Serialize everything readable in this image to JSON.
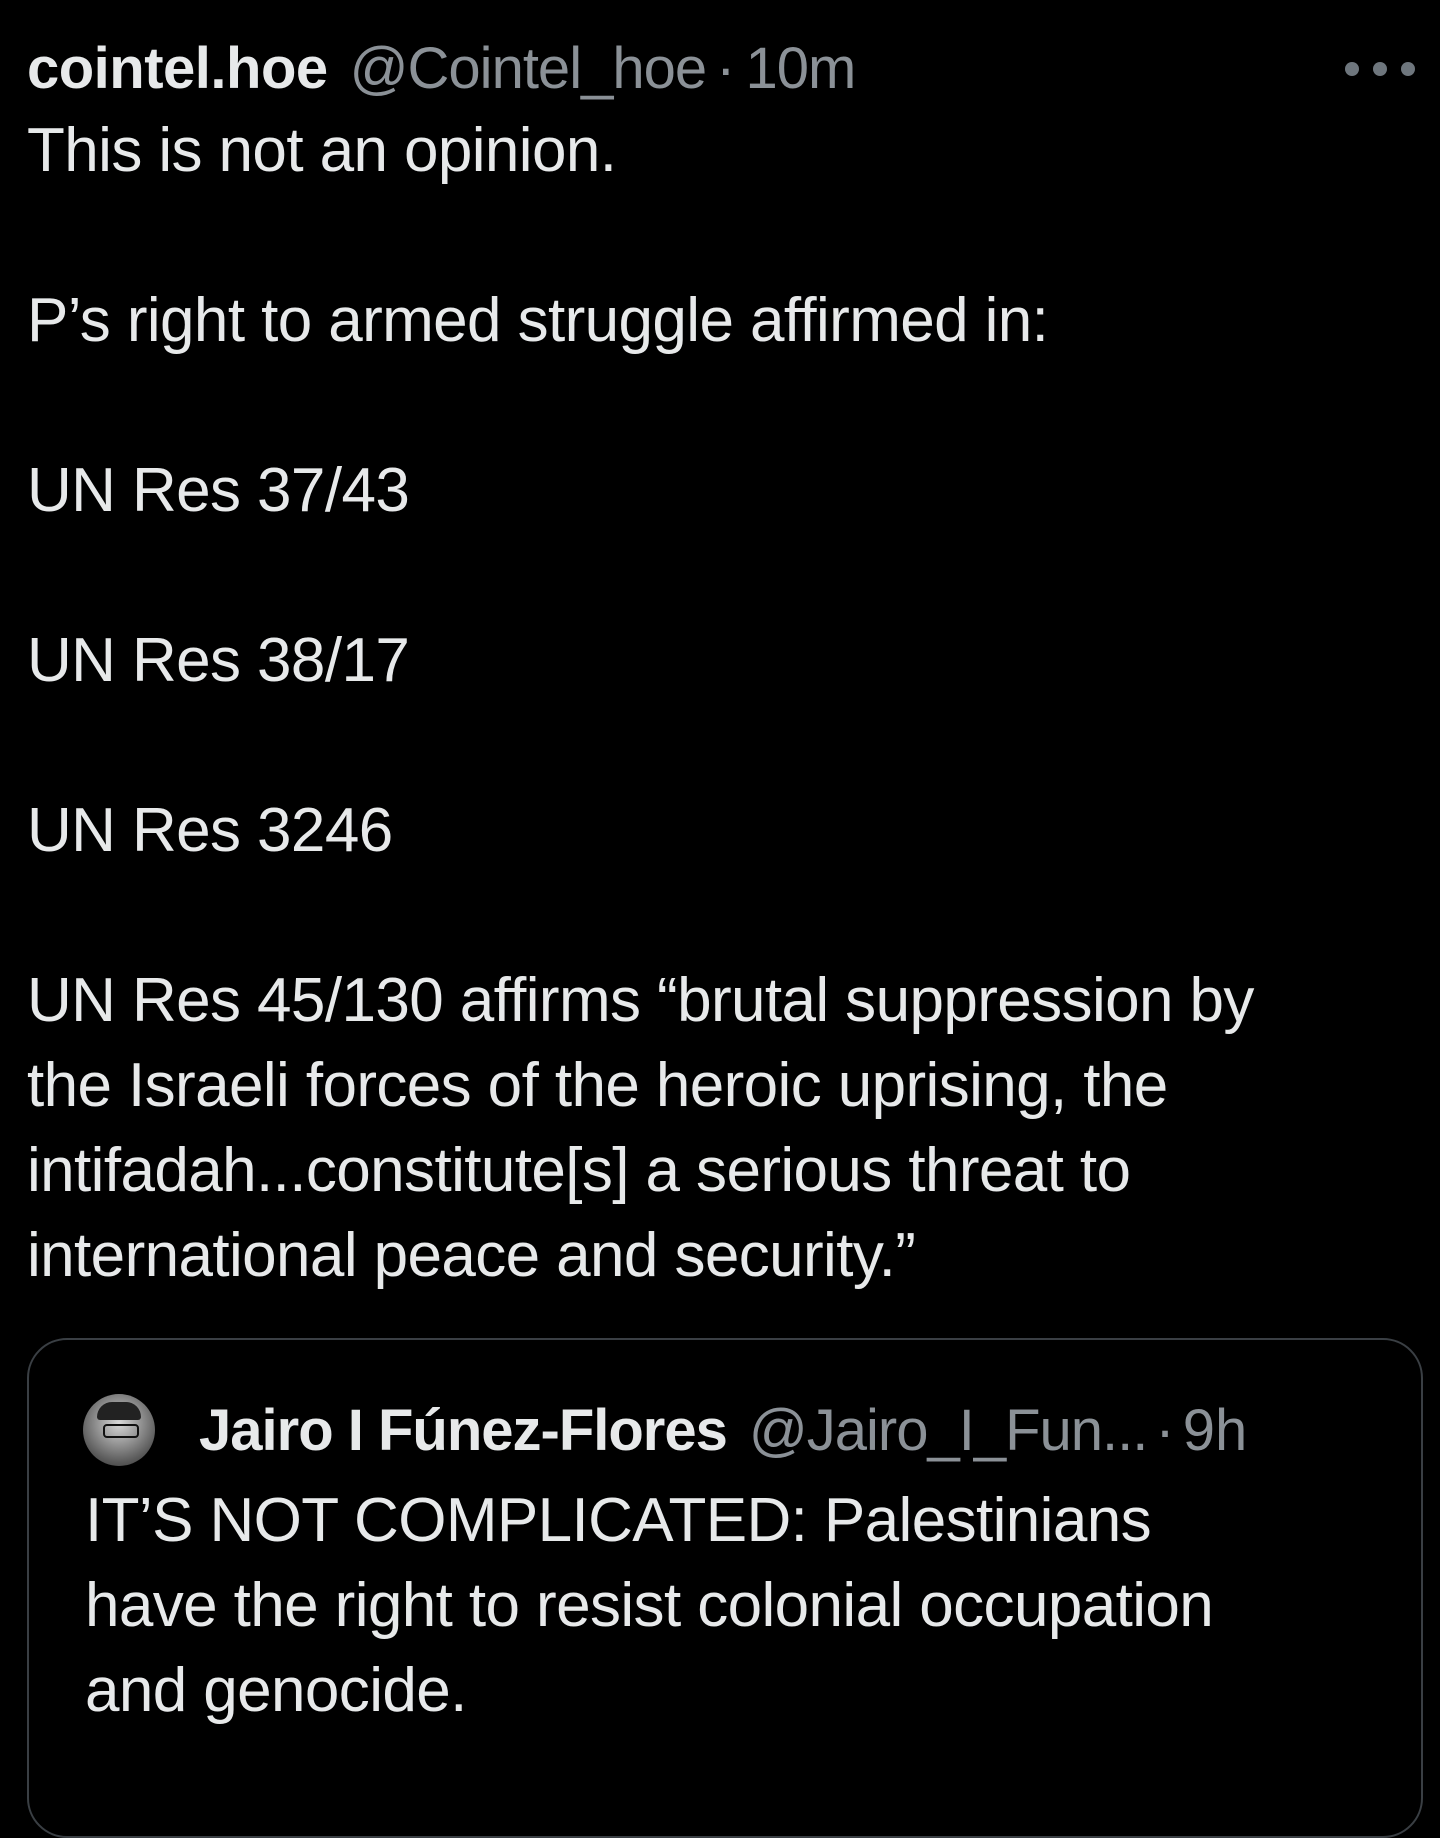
{
  "tweet": {
    "display_name": "cointel.hoe",
    "handle": "@Cointel_hoe",
    "separator": "·",
    "time": "10m",
    "more_icon": "more-horizontal-icon",
    "body": {
      "line1": "This is not an opinion.",
      "line2": "P’s right to armed struggle affirmed in:",
      "line3": "UN Res 37/43",
      "line4": "UN Res 38/17",
      "line5": "UN Res 3246",
      "para_lines": [
        "UN Res 45/130 affirms “brutal suppression by",
        "the Israeli forces of the heroic uprising, the",
        "intifadah...constitute[s] a serious threat to",
        "international peace and security.”"
      ]
    }
  },
  "quoted_tweet": {
    "display_name": "Jairo I Fúnez-Flores",
    "handle": "@Jairo_I_Fun...",
    "separator": "·",
    "time": "9h",
    "body_lines": [
      "IT’S NOT COMPLICATED: Palestinians",
      "have the right to resist colonial occupation",
      "and genocide."
    ]
  }
}
